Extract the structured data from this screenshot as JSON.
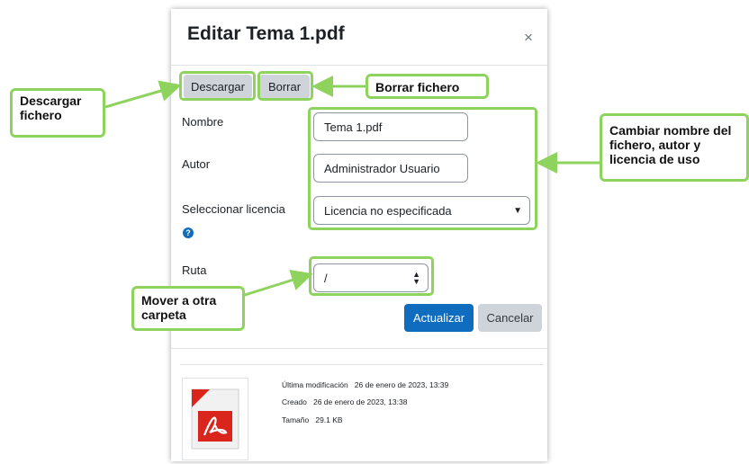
{
  "dialog": {
    "title": "Editar Tema 1.pdf",
    "close_symbol": "×"
  },
  "toolbar": {
    "download_label": "Descargar",
    "delete_label": "Borrar"
  },
  "form": {
    "name_label": "Nombre",
    "name_value": "Tema 1.pdf",
    "author_label": "Autor",
    "author_value": "Administrador Usuario",
    "license_label": "Seleccionar licencia",
    "license_value": "Licencia no especificada",
    "path_label": "Ruta",
    "path_value": "/",
    "update_label": "Actualizar",
    "cancel_label": "Cancelar"
  },
  "file_info": {
    "modified_label": "Última modificación",
    "modified_value": "26 de enero de 2023, 13:39",
    "created_label": "Creado",
    "created_value": "26 de enero de 2023, 13:38",
    "size_label": "Tamaño",
    "size_value": "29.1 KB"
  },
  "annotations": {
    "download": "Descargar fichero",
    "delete": "Borrar fichero",
    "rename": "Cambiar nombre del fichero, autor y licencia de uso",
    "move": "Mover a otra carpeta"
  },
  "colors": {
    "annotation_green": "#8fd35f",
    "primary_blue": "#0f6cbf",
    "secondary_grey": "#ced4da",
    "pdf_red": "#d9251c"
  },
  "icons": {
    "close": "close-icon",
    "help": "question-circle-icon",
    "select_arrow": "chevron-down-icon",
    "path_arrow": "sort-icon",
    "file": "pdf-file-icon"
  }
}
